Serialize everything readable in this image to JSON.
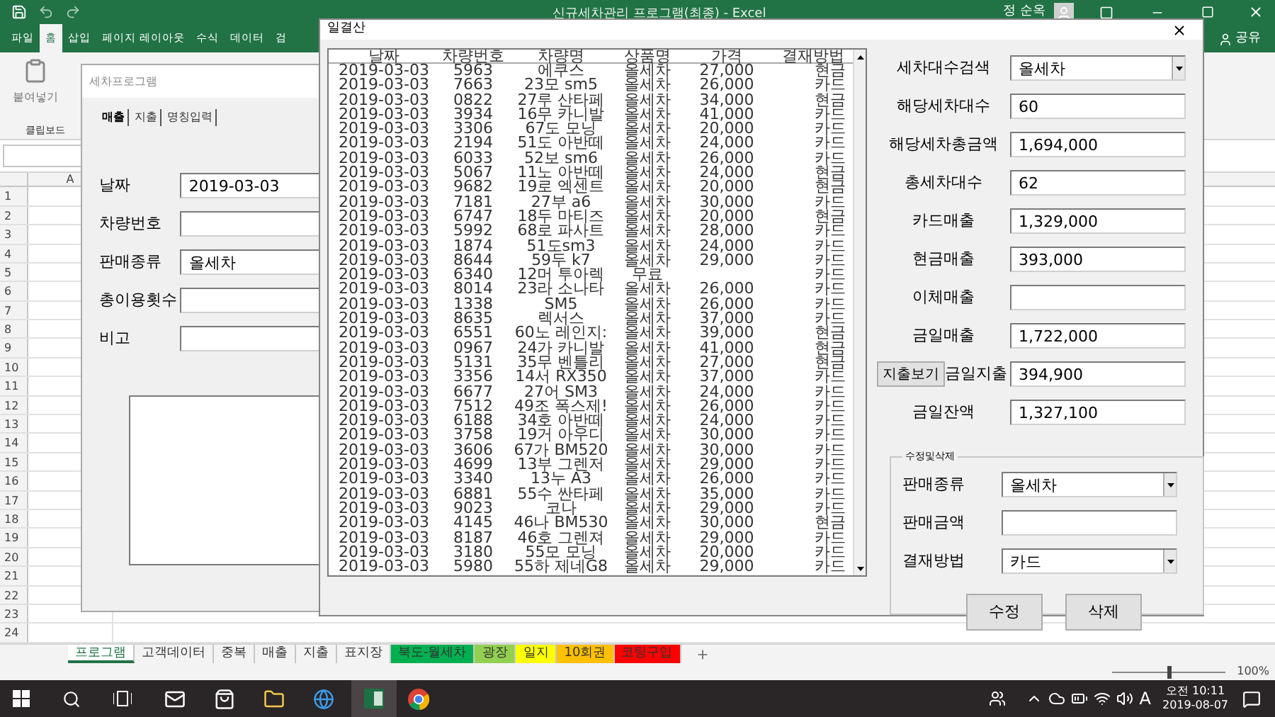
{
  "excel": {
    "title": "신규세차관리 프로그램(최종)  -  Excel",
    "user": "정 순옥",
    "ribbon_tabs": [
      {
        "label": "파일",
        "selected": false
      },
      {
        "label": "홈",
        "selected": true
      },
      {
        "label": "삽입",
        "selected": false
      },
      {
        "label": "페이지 레이아웃",
        "selected": false
      },
      {
        "label": "수식",
        "selected": false
      },
      {
        "label": "데이터",
        "selected": false
      },
      {
        "label": "검",
        "selected": false
      }
    ],
    "share": "공유",
    "paste": "붙여넣기",
    "clipboard_group": "클립보드",
    "column": "A",
    "rows": [
      "1",
      "2",
      "3",
      "4",
      "5",
      "6",
      "7",
      "8",
      "9",
      "10",
      "11",
      "12",
      "13",
      "14",
      "15",
      "16",
      "17",
      "18",
      "19",
      "20",
      "21",
      "22",
      "23",
      "24"
    ],
    "sheet_tabs": [
      {
        "label": "프로그램",
        "selected": true
      },
      {
        "label": "고객데이터",
        "selected": false
      },
      {
        "label": "중복",
        "selected": false
      },
      {
        "label": "매출",
        "selected": false
      },
      {
        "label": "지출",
        "selected": false
      },
      {
        "label": "표지장",
        "selected": false
      },
      {
        "label": "북도-월세차",
        "selected": false,
        "color": "#00b050"
      },
      {
        "label": "광장",
        "selected": false,
        "color": "#92d050"
      },
      {
        "label": "일지",
        "selected": false,
        "color": "#ffff00"
      },
      {
        "label": "10회권",
        "selected": false,
        "color": "#ffc000"
      },
      {
        "label": "코팅구입",
        "selected": false,
        "color": "#ff0000"
      }
    ],
    "zoom_slider": {
      "level": 0.5
    },
    "zoom": "100%"
  },
  "program_dialog": {
    "title": "세차프로그램",
    "tabs": [
      {
        "label": "매출",
        "selected": true
      },
      {
        "label": "지출",
        "selected": false
      },
      {
        "label": "명칭입력",
        "selected": false
      }
    ],
    "fields": [
      {
        "label": "날짜",
        "value": "2019-03-03"
      },
      {
        "label": "차량번호"
      },
      {
        "label": "판매종류",
        "value": "올세차"
      },
      {
        "label": "총이용횟수"
      },
      {
        "label": "비고"
      }
    ]
  },
  "settlement_dialog": {
    "title": "일결산",
    "columns": [
      "날짜",
      "차량번호",
      "차량명",
      "상품명",
      "가격",
      "결재방법"
    ],
    "rows": [
      {
        "date": "2019-03-03",
        "number": "5963",
        "car": "에쿠스",
        "product": "올세차",
        "price": "27,000",
        "payment": "현금"
      },
      {
        "date": "2019-03-03",
        "number": "7663",
        "car": "23모 sm5",
        "product": "올세차",
        "price": "26,000",
        "payment": "카드"
      },
      {
        "date": "2019-03-03",
        "number": "0822",
        "car": "27루 산타페",
        "product": "올세차",
        "price": "34,000",
        "payment": "현금"
      },
      {
        "date": "2019-03-03",
        "number": "3934",
        "car": "16무 카니발",
        "product": "올세차",
        "price": "41,000",
        "payment": "카드"
      },
      {
        "date": "2019-03-03",
        "number": "3306",
        "car": "67도 모닝",
        "product": "올세차",
        "price": "20,000",
        "payment": "카드"
      },
      {
        "date": "2019-03-03",
        "number": "2194",
        "car": "51도 아반떼",
        "product": "올세차",
        "price": "24,000",
        "payment": "카드"
      },
      {
        "date": "2019-03-03",
        "number": "6033",
        "car": "52보 sm6",
        "product": "올세차",
        "price": "26,000",
        "payment": "카드"
      },
      {
        "date": "2019-03-03",
        "number": "5067",
        "car": "11노 아반떼",
        "product": "올세차",
        "price": "24,000",
        "payment": "현금"
      },
      {
        "date": "2019-03-03",
        "number": "9682",
        "car": "19로 엑센트",
        "product": "올세차",
        "price": "20,000",
        "payment": "현금"
      },
      {
        "date": "2019-03-03",
        "number": "7181",
        "car": "27부 a6",
        "product": "올세차",
        "price": "30,000",
        "payment": "카드"
      },
      {
        "date": "2019-03-03",
        "number": "6747",
        "car": "18두 마티즈",
        "product": "올세차",
        "price": "20,000",
        "payment": "현금"
      },
      {
        "date": "2019-03-03",
        "number": "5992",
        "car": "68로 파사트",
        "product": "올세차",
        "price": "28,000",
        "payment": "카드"
      },
      {
        "date": "2019-03-03",
        "number": "1874",
        "car": "51도sm3",
        "product": "올세차",
        "price": "24,000",
        "payment": "카드"
      },
      {
        "date": "2019-03-03",
        "number": "8644",
        "car": "59두 k7",
        "product": "올세차",
        "price": "29,000",
        "payment": "카드"
      },
      {
        "date": "2019-03-03",
        "number": "6340",
        "car": "12머 투아렉",
        "product": "무료",
        "payment": "카드"
      },
      {
        "date": "2019-03-03",
        "number": "8014",
        "car": "23라 소나타",
        "product": "올세차",
        "price": "26,000",
        "payment": "카드"
      },
      {
        "date": "2019-03-03",
        "number": "1338",
        "car": "SM5",
        "product": "올세차",
        "price": "26,000",
        "payment": "카드"
      },
      {
        "date": "2019-03-03",
        "number": "8635",
        "car": "렉서스",
        "product": "올세차",
        "price": "37,000",
        "payment": "카드"
      },
      {
        "date": "2019-03-03",
        "number": "6551",
        "car": "60노 레인지:",
        "product": "올세차",
        "price": "39,000",
        "payment": "현금"
      },
      {
        "date": "2019-03-03",
        "number": "0967",
        "car": "24가 카니발",
        "product": "올세차",
        "price": "41,000",
        "payment": "현금"
      },
      {
        "date": "2019-03-03",
        "number": "5131",
        "car": "35무 벤틀리",
        "product": "올세차",
        "price": "27,000",
        "payment": "현금"
      },
      {
        "date": "2019-03-03",
        "number": "3356",
        "car": "14서 RX350",
        "product": "올세차",
        "price": "37,000",
        "payment": "카드"
      },
      {
        "date": "2019-03-03",
        "number": "6677",
        "car": "27어 SM3",
        "product": "올세차",
        "price": "24,000",
        "payment": "카드"
      },
      {
        "date": "2019-03-03",
        "number": "7512",
        "car": "49조 폭스제!",
        "product": "올세차",
        "price": "26,000",
        "payment": "카드"
      },
      {
        "date": "2019-03-03",
        "number": "6188",
        "car": "34호 아반떼",
        "product": "올세차",
        "price": "24,000",
        "payment": "카드"
      },
      {
        "date": "2019-03-03",
        "number": "3758",
        "car": "19거 아우디",
        "product": "올세차",
        "price": "30,000",
        "payment": "카드"
      },
      {
        "date": "2019-03-03",
        "number": "3606",
        "car": "67가 BM520",
        "product": "올세차",
        "price": "30,000",
        "payment": "카드"
      },
      {
        "date": "2019-03-03",
        "number": "4699",
        "car": "13부 그렌저",
        "product": "올세차",
        "price": "29,000",
        "payment": "카드"
      },
      {
        "date": "2019-03-03",
        "number": "3340",
        "car": "13누 A3",
        "product": "올세차",
        "price": "26,000",
        "payment": "카드"
      },
      {
        "date": "2019-03-03",
        "number": "6881",
        "car": "55수 싼타페",
        "product": "올세차",
        "price": "35,000",
        "payment": "카드"
      },
      {
        "date": "2019-03-03",
        "number": "9023",
        "car": "코나",
        "product": "올세차",
        "price": "29,000",
        "payment": "카드"
      },
      {
        "date": "2019-03-03",
        "number": "4145",
        "car": "46나 BM530",
        "product": "올세차",
        "price": "30,000",
        "payment": "현금"
      },
      {
        "date": "2019-03-03",
        "number": "8187",
        "car": "46호 그렌져",
        "product": "올세차",
        "price": "29,000",
        "payment": "카드"
      },
      {
        "date": "2019-03-03",
        "number": "3180",
        "car": "55모 모닝",
        "product": "올세차",
        "price": "20,000",
        "payment": "카드"
      },
      {
        "date": "2019-03-03",
        "number": "5980",
        "car": "55하 제네G8",
        "product": "올세차",
        "price": "29,000",
        "payment": "카드"
      }
    ],
    "summary": [
      {
        "label": "세차대수검색",
        "value": "올세차",
        "kind": "combo"
      },
      {
        "label": "해당세차대수",
        "value": "60",
        "kind": "field"
      },
      {
        "label": "해당세차총금액",
        "value": "1,694,000",
        "kind": "field"
      },
      {
        "label": "총세차대수",
        "value": "62",
        "kind": "field"
      },
      {
        "label": "카드매출",
        "value": "1,329,000",
        "kind": "field"
      },
      {
        "label": "현금매출",
        "value": "393,000",
        "kind": "field"
      },
      {
        "label": "이체매출",
        "kind": "field"
      },
      {
        "label": "금일매출",
        "value": "1,722,000",
        "kind": "field"
      },
      {
        "label": "금일지출",
        "value": "394,900",
        "kind": "field",
        "button": "지출보기"
      },
      {
        "label": "금일잔액",
        "value": "1,327,100",
        "kind": "field"
      }
    ],
    "edit_group": {
      "title": "수정및삭제",
      "fields": [
        {
          "label": "판매종류",
          "value": "올세차",
          "kind": "combo"
        },
        {
          "label": "판매금액",
          "kind": "field"
        },
        {
          "label": "결재방법",
          "value": "카드",
          "kind": "combo"
        }
      ],
      "buttons": [
        "수정",
        "삭제"
      ]
    }
  },
  "taskbar": {
    "ime": "A",
    "time": "오전 10:11",
    "date": "2019-08-07"
  }
}
